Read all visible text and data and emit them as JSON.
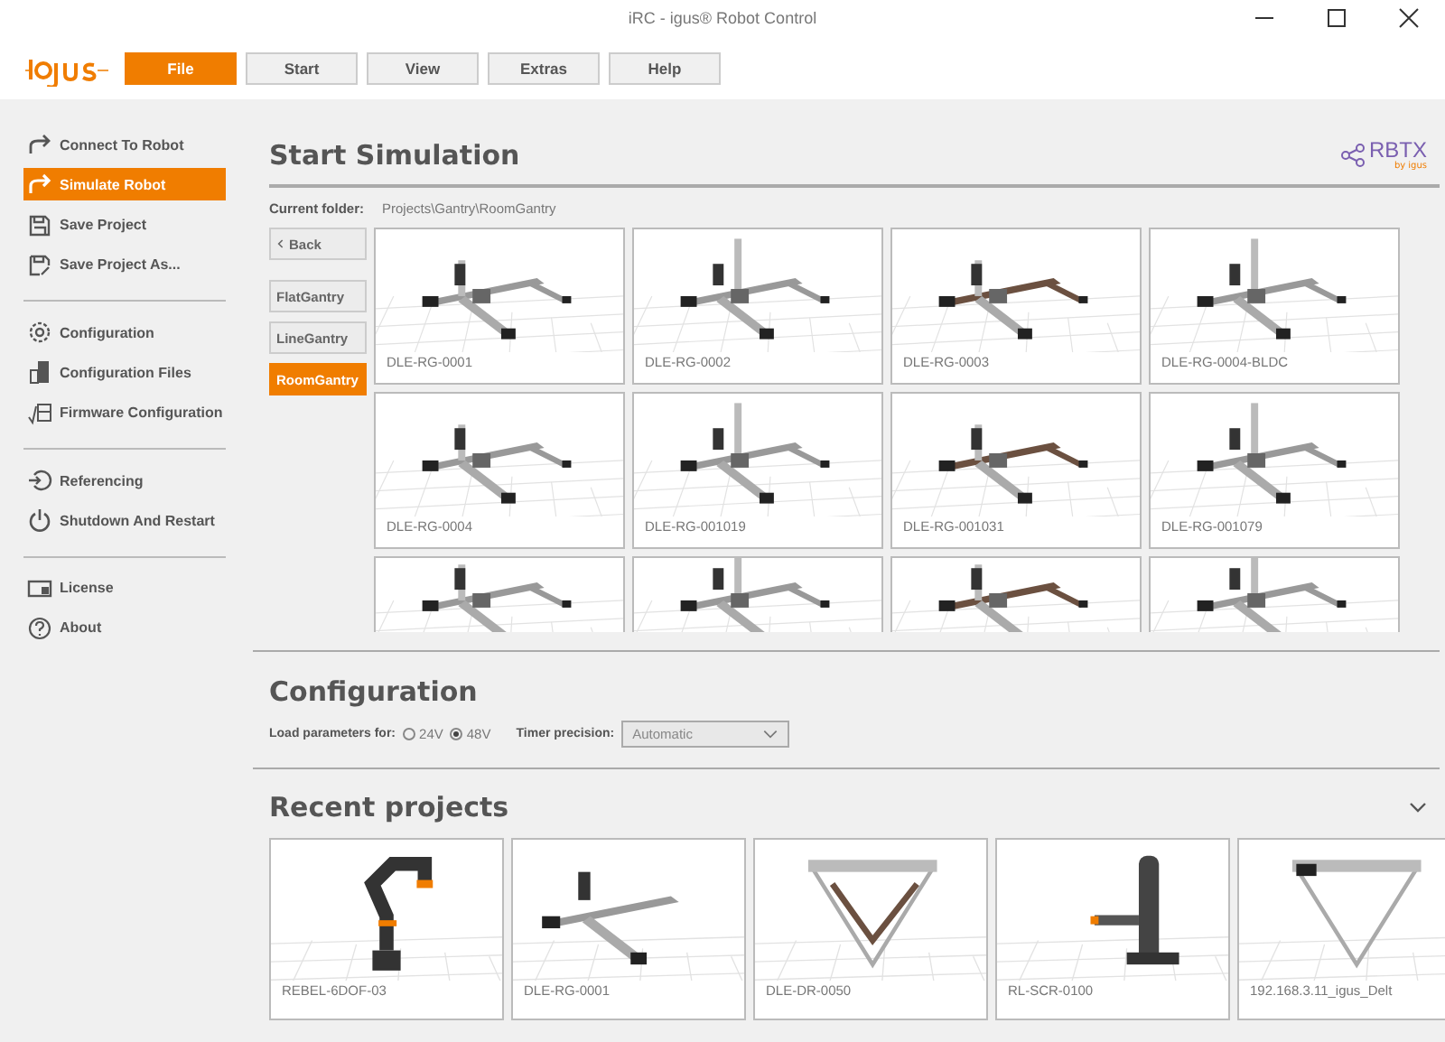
{
  "window": {
    "title": "iRC - igus® Robot Control"
  },
  "menu": [
    {
      "label": "File",
      "selected": true
    },
    {
      "label": "Start",
      "selected": false
    },
    {
      "label": "View",
      "selected": false
    },
    {
      "label": "Extras",
      "selected": false
    },
    {
      "label": "Help",
      "selected": false
    }
  ],
  "sidebar": {
    "groups": [
      [
        {
          "label": "Connect To Robot",
          "selected": false
        },
        {
          "label": "Simulate Robot",
          "selected": true
        },
        {
          "label": "Save Project",
          "selected": false
        },
        {
          "label": "Save Project As...",
          "selected": false
        }
      ],
      [
        {
          "label": "Configuration",
          "selected": false
        },
        {
          "label": "Configuration Files",
          "selected": false
        },
        {
          "label": "Firmware Configuration",
          "selected": false
        }
      ],
      [
        {
          "label": "Referencing",
          "selected": false
        },
        {
          "label": "Shutdown And Restart",
          "selected": false
        }
      ],
      [
        {
          "label": "License",
          "selected": false
        },
        {
          "label": "About",
          "selected": false
        }
      ]
    ]
  },
  "simulation": {
    "title": "Start Simulation",
    "brand": "RBTX",
    "brand_sub": "by igus",
    "folder_label": "Current folder:",
    "folder_path": "Projects\\Gantry\\RoomGantry",
    "back": "Back",
    "folders": [
      {
        "label": "FlatGantry",
        "selected": false
      },
      {
        "label": "LineGantry",
        "selected": false
      },
      {
        "label": "RoomGantry",
        "selected": true
      }
    ],
    "tiles": [
      {
        "label": "DLE-RG-0001"
      },
      {
        "label": "DLE-RG-0002"
      },
      {
        "label": "DLE-RG-0003"
      },
      {
        "label": "DLE-RG-0004-BLDC"
      },
      {
        "label": "DLE-RG-0004"
      },
      {
        "label": "DLE-RG-001019"
      },
      {
        "label": "DLE-RG-001031"
      },
      {
        "label": "DLE-RG-001079"
      },
      {
        "kind": "picture"
      },
      {
        "kind": "picture"
      },
      {
        "kind": "picture"
      },
      {
        "kind": "picture"
      }
    ]
  },
  "configuration": {
    "title": "Configuration",
    "load_label": "Load parameters for:",
    "voltages": [
      {
        "label": "24V",
        "selected": false
      },
      {
        "label": "48V",
        "selected": true
      }
    ],
    "timer_label": "Timer precision:",
    "timer_value": "Automatic"
  },
  "recent": {
    "title": "Recent projects",
    "expanded": true,
    "projects": [
      {
        "label": "REBEL-6DOF-03"
      },
      {
        "label": "DLE-RG-0001"
      },
      {
        "label": "DLE-DR-0050"
      },
      {
        "label": "RL-SCR-0100"
      },
      {
        "label": "192.168.3.11_igus_Delt"
      }
    ]
  }
}
